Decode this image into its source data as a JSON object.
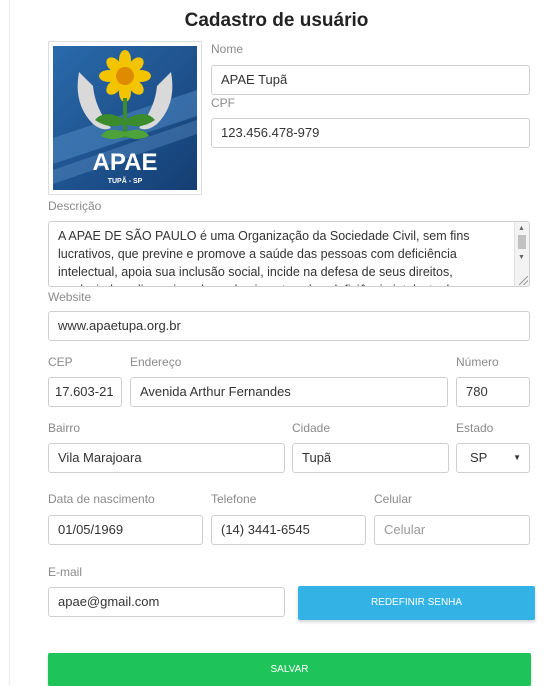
{
  "header": {
    "title": "Cadastro de usuário"
  },
  "logo": {
    "org_text": "APAE",
    "city_text": "TUPÃ - SP"
  },
  "fields": {
    "nome": {
      "label": "Nome",
      "value": "APAE Tupã"
    },
    "cpf": {
      "label": "CPF",
      "value": "123.456.478-979"
    },
    "descricao": {
      "label": "Descrição",
      "value": "A APAE DE SÃO PAULO é uma Organização da Sociedade Civil, sem fins lucrativos, que previne e promove a saúde das pessoas com deficiência intelectual, apoia sua inclusão social, incide na defesa de seus direitos, produzindo e disseminando conhecimento sobre deficiência intelectual e seus fatores"
    },
    "website": {
      "label": "Website",
      "value": "www.apaetupa.org.br"
    },
    "cep": {
      "label": "CEP",
      "value": "17.603-21"
    },
    "endereco": {
      "label": "Endereço",
      "value": "Avenida Arthur Fernandes"
    },
    "numero": {
      "label": "Número",
      "value": "780"
    },
    "bairro": {
      "label": "Bairro",
      "value": "Vila Marajoara"
    },
    "cidade": {
      "label": "Cidade",
      "value": "Tupã"
    },
    "estado": {
      "label": "Estado",
      "value": "SP"
    },
    "nascimento": {
      "label": "Data de nascimento",
      "value": "01/05/1969"
    },
    "telefone": {
      "label": "Telefone",
      "value": "(14) 3441-6545"
    },
    "celular": {
      "label": "Celular",
      "placeholder": "Celular"
    },
    "email": {
      "label": "E-mail",
      "value": "apae@gmail.com"
    }
  },
  "buttons": {
    "reset_password": "REDEFINIR SENHA",
    "save": "SALVAR"
  },
  "colors": {
    "reset_button": "#33b3e5",
    "save_button": "#1ec35a",
    "logo_blue": "#1a4f8b",
    "logo_yellow": "#f5c400",
    "logo_green": "#3a8c2c"
  }
}
